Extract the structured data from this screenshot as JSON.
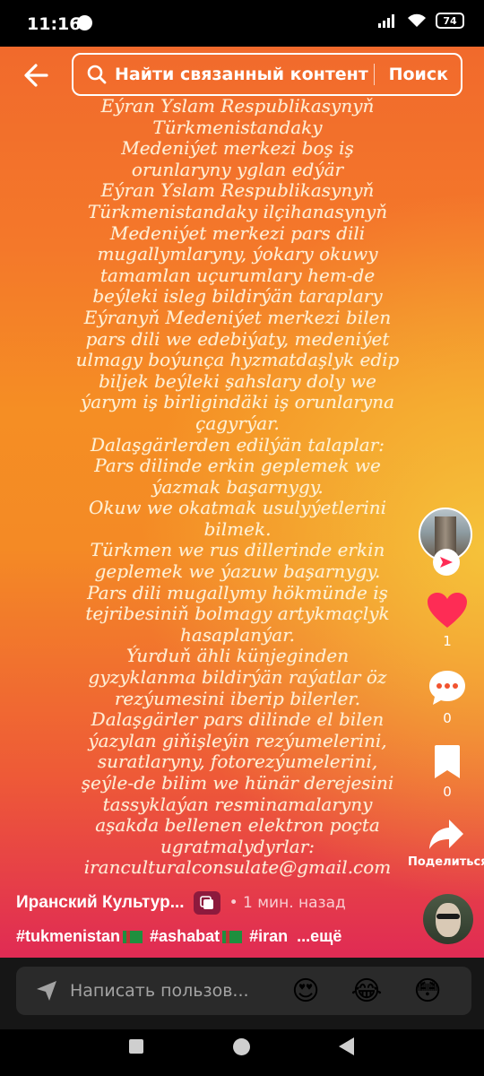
{
  "status_bar": {
    "time": "11:16",
    "battery": "74"
  },
  "search": {
    "query": "Найти связанный контент",
    "button_label": "Поиск"
  },
  "post_text_lines": [
    "Eýran Yslam Respublikasynyň",
    "Türkmenistandaky",
    "Medeniýet merkezi boş iş",
    "orunlaryny yglan edýär",
    "Eýran Yslam Respublikasynyň",
    "Türkmenistandaky ilçihanasynyň",
    "Medeniýet merkezi pars dili",
    "mugallymlaryny, ýokary okuwy",
    "tamamlan uçurumlary hem-de",
    "beýleki isleg bildirýän taraplary",
    "Eýranyň Medeniýet merkezi bilen",
    "pars dili we edebiýaty, medeniýet",
    "ulmagy boýunça hyzmatdaşlyk edip",
    "biljek beýleki şahslary doly we",
    "ýarym iş birligindäki iş orunlaryna",
    "çagyrýar.",
    "Dalaşgärlerden edilýän talaplar:",
    "Pars dilinde erkin gepleme​k we",
    "ýazmak başarnygy.",
    "Okuw we okatmak usulyýetlerini",
    "bilmek.",
    "Türkmen we rus dillerinde erkin",
    "geplemek we ýazuw başarnygy.",
    "Pars dili mugallymy hökmünde iş",
    "tejribesiniň bolmagy artykmaçlyk",
    "hasaplanýar.",
    "Ýurduň ähli künjeginden",
    "gyzyklanma bildirýän raýatlar öz",
    "rezýumesini iberip bilerler.",
    "Dalaşgärler pars dilinde el bilen",
    "ýazylan giňişleýin rezýumelerini,",
    "suratlaryny, fotorezýumelerini,",
    "şeýle-de bilim we hünär derejesini",
    "tassyklaýan resminamalaryny",
    "aşakda bellenen elektron poçta",
    "ugratmalydyrlar:",
    "iranculturalconsulate@gmail.com"
  ],
  "actions": {
    "likes": "1",
    "comments": "0",
    "bookmarks": "0",
    "share_label": "Поделиться"
  },
  "author": {
    "name": "Иранский Культур...",
    "time_ago": "• 1 мин. назад"
  },
  "hashtags": [
    "#tukmenistan",
    "#ashabat",
    "#iran"
  ],
  "more_label": "...ещё",
  "comment": {
    "placeholder": "Написать пользов..."
  },
  "emojis": [
    "😍",
    "😂",
    "😳"
  ],
  "colors": {
    "like": "#fe2c55",
    "badge": "#8d1a3d"
  }
}
